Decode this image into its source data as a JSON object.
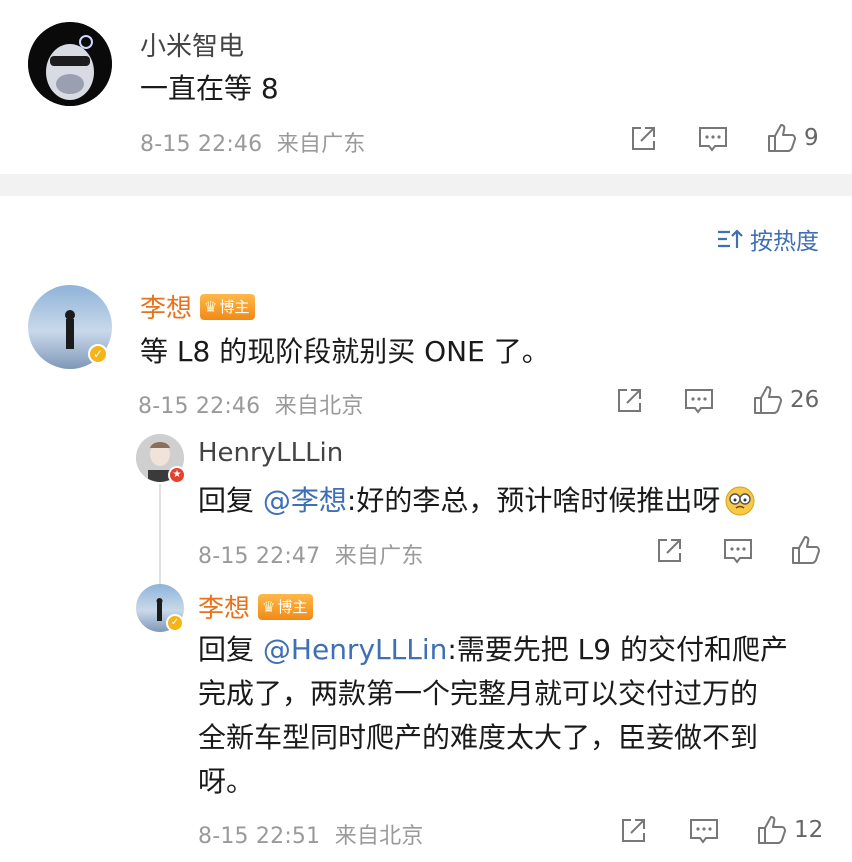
{
  "comment1": {
    "author": "小米智电",
    "text": "一直在等 8",
    "time": "8-15 22:46",
    "location": "来自广东",
    "likes": "9"
  },
  "sort": {
    "label": "按热度"
  },
  "comment2": {
    "author": "李想",
    "badge": "博主",
    "text": "等 L8 的现阶段就别买 ONE 了。",
    "time": "8-15 22:46",
    "location": "来自北京",
    "likes": "26"
  },
  "reply1": {
    "author": "HenryLLLin",
    "prefix": "回复 ",
    "mention": "@李想",
    "text": ":好的李总，预计啥时候推出呀",
    "time": "8-15 22:47",
    "location": "来自广东"
  },
  "reply2": {
    "author": "李想",
    "badge": "博主",
    "prefix": "回复 ",
    "mention": "@HenryLLLin",
    "line1": ":需要先把 L9 的交付和爬产",
    "line2": "完成了，两款第一个完整月就可以交付过万的",
    "line3": "全新车型同时爬产的难度太大了，臣妾做不到",
    "line4": "呀。",
    "time": "8-15 22:51",
    "location": "来自北京",
    "likes": "12"
  },
  "colors": {
    "accent": "#e8731c",
    "mention": "#3f6fb4",
    "meta": "#9a9a9a"
  },
  "icons": [
    "share-icon",
    "comment-icon",
    "like-icon",
    "sort-icon",
    "emoji-icon",
    "crown-icon",
    "verified-icon"
  ]
}
